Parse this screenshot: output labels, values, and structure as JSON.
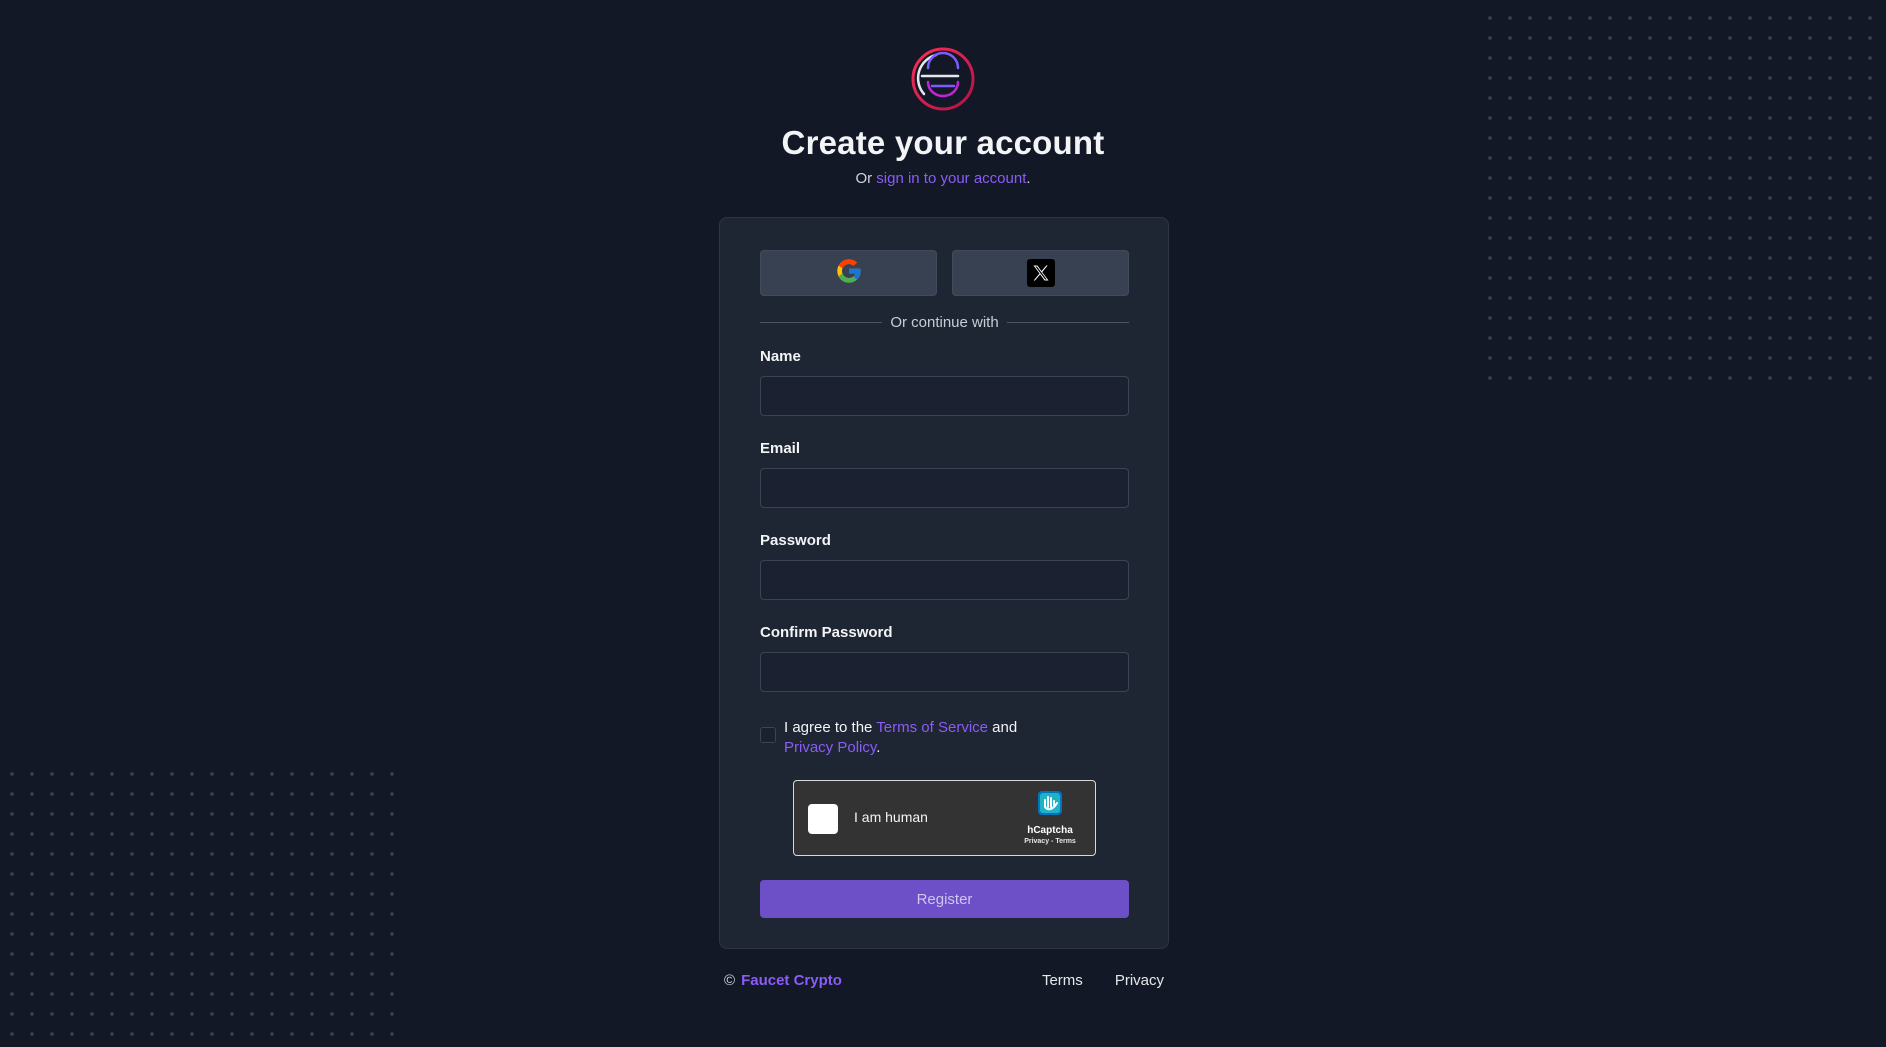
{
  "header": {
    "title": "Create your account",
    "subtitle_prefix": "Or ",
    "subtitle_link": "sign in to your account",
    "subtitle_suffix": "."
  },
  "social": {
    "google_icon": "google-icon",
    "x_icon": "x-icon"
  },
  "divider_text": "Or continue with",
  "fields": {
    "name": {
      "label": "Name",
      "value": ""
    },
    "email": {
      "label": "Email",
      "value": ""
    },
    "password": {
      "label": "Password",
      "value": ""
    },
    "confirm_password": {
      "label": "Confirm Password",
      "value": ""
    }
  },
  "agreement": {
    "prefix": "I agree to the ",
    "terms_link": "Terms of Service",
    "middle": " and",
    "privacy_link": "Privacy Policy",
    "suffix": "."
  },
  "captcha": {
    "label": "I am human",
    "brand": "hCaptcha",
    "links": "Privacy - Terms"
  },
  "register_label": "Register",
  "footer": {
    "copyright": "©",
    "brand": "Faucet Crypto",
    "terms": "Terms",
    "privacy": "Privacy"
  },
  "colors": {
    "background": "#121826",
    "card": "#1e2533",
    "accent": "#8b5cf6",
    "button": "#6d4fc7"
  }
}
